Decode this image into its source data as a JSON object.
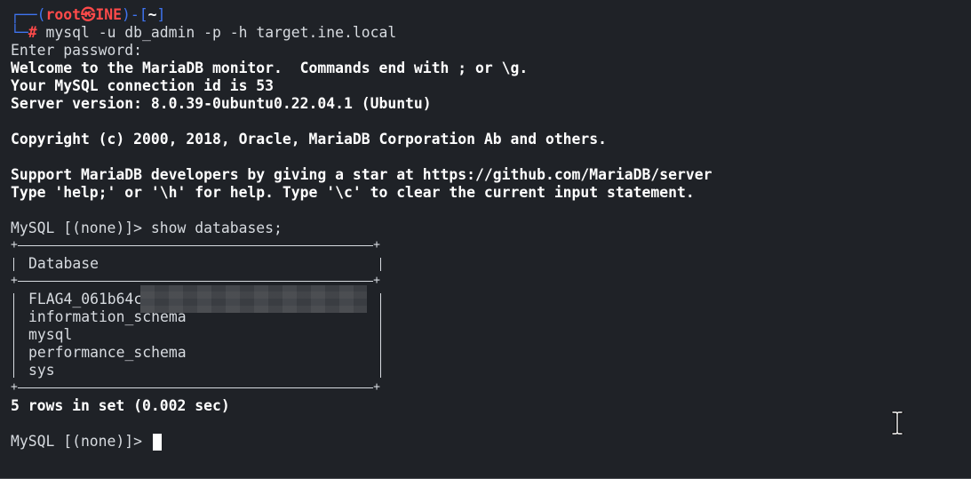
{
  "prompt": {
    "top_frame": "┌──(",
    "user": "root",
    "at_symbol": "㉿",
    "host": "INE",
    "mid_frame": ")-[",
    "dir": "~",
    "end_frame": "]",
    "bottom_frame": "└─",
    "hash": "#",
    "command": " mysql -u db_admin -p -h target.ine.local"
  },
  "output": {
    "enter_password": "Enter password: ",
    "welcome": "Welcome to the MariaDB monitor.  Commands end with ; or \\g.",
    "connection_id": "Your MySQL connection id is 53",
    "server_version": "Server version: 8.0.39-0ubuntu0.22.04.1 (Ubuntu)",
    "copyright": "Copyright (c) 2000, 2018, Oracle, MariaDB Corporation Ab and others.",
    "support": "Support MariaDB developers by giving a star at https://github.com/MariaDB/server",
    "help": "Type 'help;' or '\\h' for help. Type '\\c' to clear the current input statement."
  },
  "query": {
    "prompt": "MySQL [(none)]> ",
    "command": "show databases;"
  },
  "table": {
    "header": "Database",
    "rows": [
      "FLAG4_061b64c",
      "information_schema",
      "mysql",
      "performance_schema",
      "sys"
    ],
    "footer": "5 rows in set (0.002 sec)"
  },
  "final_prompt": "MySQL [(none)]> ",
  "colors": {
    "background": "#1f2227",
    "frame_blue": "#3f74f0",
    "prompt_red": "#ff4a4a",
    "text": "#d7dbe0"
  }
}
